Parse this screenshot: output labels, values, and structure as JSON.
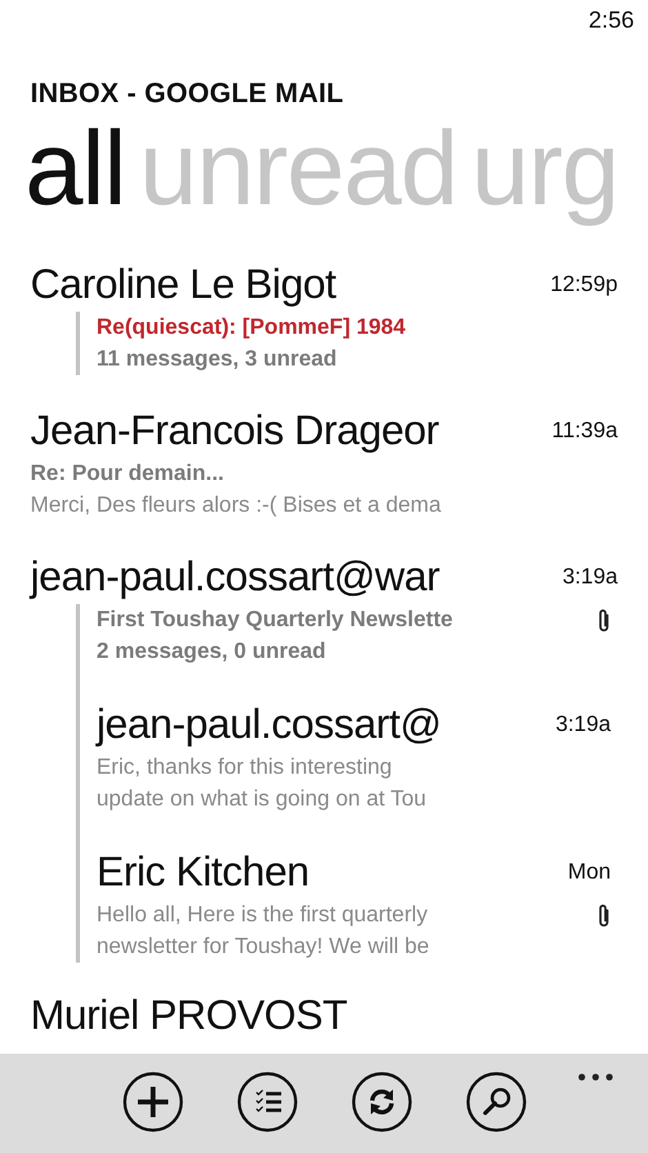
{
  "status_bar": {
    "time": "2:56"
  },
  "title": "INBOX - GOOGLE MAIL",
  "pivots": [
    {
      "label": "all",
      "selected": true
    },
    {
      "label": "unread",
      "selected": false
    },
    {
      "label": "urg",
      "selected": false
    }
  ],
  "messages": [
    {
      "kind": "thread",
      "sender": "Caroline Le Bigot",
      "time": "12:59p",
      "subject": "Re(quiescat): [PommeF] 1984",
      "unread": true,
      "attachment": false,
      "summary": "11 messages, 3 unread"
    },
    {
      "kind": "message",
      "sender": "Jean-Francois Drageor",
      "time": "11:39a",
      "subject": "Re: Pour demain...",
      "unread": false,
      "attachment": false,
      "preview": [
        "Merci, Des fleurs alors :-( Bises et a dema"
      ]
    },
    {
      "kind": "thread",
      "sender": "jean-paul.cossart@war",
      "time": "3:19a",
      "subject": "First Toushay Quarterly Newslette",
      "unread": false,
      "attachment": true,
      "summary": "2 messages, 0 unread",
      "children": [
        {
          "sender": "jean-paul.cossart@",
          "time": "3:19a",
          "attachment": false,
          "preview": [
            "Eric, thanks for this interesting",
            "update on what is going on at Tou"
          ]
        },
        {
          "sender": "Eric Kitchen",
          "time": "Mon",
          "attachment": true,
          "preview": [
            "Hello all, Here is the first quarterly",
            "newsletter for Toushay! We will be"
          ]
        }
      ]
    },
    {
      "kind": "message",
      "sender": "Muriel PROVOST"
    }
  ],
  "app_bar": {
    "buttons": [
      {
        "kind": "add"
      },
      {
        "kind": "select"
      },
      {
        "kind": "sync"
      },
      {
        "kind": "search"
      }
    ]
  }
}
